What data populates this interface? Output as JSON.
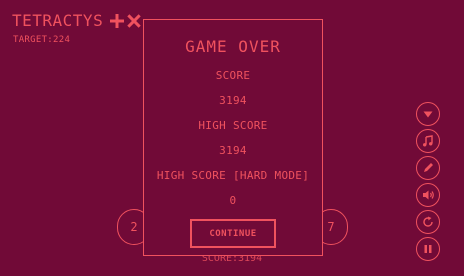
{
  "header": {
    "title": "TETRACTYS",
    "target": "TARGET:224",
    "icons": [
      "plus-icon",
      "cross-icon"
    ]
  },
  "board": {
    "left_token": "2",
    "right_token": "7",
    "score_label": "SCORE:3194"
  },
  "modal": {
    "title": "GAME OVER",
    "score_label": "SCORE",
    "score_value": "3194",
    "high_score_label": "HIGH SCORE",
    "high_score_value": "3194",
    "hard_mode_label": "HIGH SCORE [HARD MODE]",
    "hard_mode_value": "0",
    "continue_label": "CONTINUE"
  },
  "controls": [
    {
      "icon": "chevron-down-icon"
    },
    {
      "icon": "music-note-icon"
    },
    {
      "icon": "pencil-icon"
    },
    {
      "icon": "volume-icon"
    },
    {
      "icon": "restart-icon"
    },
    {
      "icon": "pause-icon"
    }
  ],
  "colors": {
    "background": "#710a37",
    "accent": "#f0525e"
  }
}
